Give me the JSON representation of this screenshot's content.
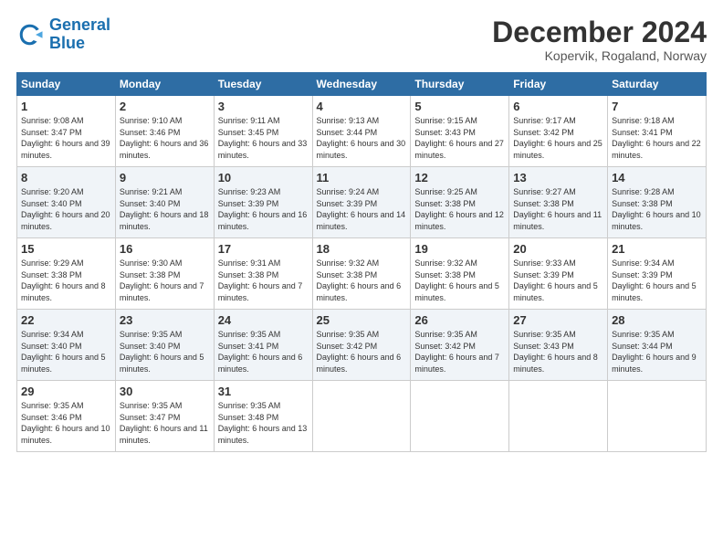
{
  "logo": {
    "line1": "General",
    "line2": "Blue"
  },
  "header": {
    "month": "December 2024",
    "location": "Kopervik, Rogaland, Norway"
  },
  "weekdays": [
    "Sunday",
    "Monday",
    "Tuesday",
    "Wednesday",
    "Thursday",
    "Friday",
    "Saturday"
  ],
  "weeks": [
    [
      {
        "day": 1,
        "sunrise": "Sunrise: 9:08 AM",
        "sunset": "Sunset: 3:47 PM",
        "daylight": "Daylight: 6 hours and 39 minutes."
      },
      {
        "day": 2,
        "sunrise": "Sunrise: 9:10 AM",
        "sunset": "Sunset: 3:46 PM",
        "daylight": "Daylight: 6 hours and 36 minutes."
      },
      {
        "day": 3,
        "sunrise": "Sunrise: 9:11 AM",
        "sunset": "Sunset: 3:45 PM",
        "daylight": "Daylight: 6 hours and 33 minutes."
      },
      {
        "day": 4,
        "sunrise": "Sunrise: 9:13 AM",
        "sunset": "Sunset: 3:44 PM",
        "daylight": "Daylight: 6 hours and 30 minutes."
      },
      {
        "day": 5,
        "sunrise": "Sunrise: 9:15 AM",
        "sunset": "Sunset: 3:43 PM",
        "daylight": "Daylight: 6 hours and 27 minutes."
      },
      {
        "day": 6,
        "sunrise": "Sunrise: 9:17 AM",
        "sunset": "Sunset: 3:42 PM",
        "daylight": "Daylight: 6 hours and 25 minutes."
      },
      {
        "day": 7,
        "sunrise": "Sunrise: 9:18 AM",
        "sunset": "Sunset: 3:41 PM",
        "daylight": "Daylight: 6 hours and 22 minutes."
      }
    ],
    [
      {
        "day": 8,
        "sunrise": "Sunrise: 9:20 AM",
        "sunset": "Sunset: 3:40 PM",
        "daylight": "Daylight: 6 hours and 20 minutes."
      },
      {
        "day": 9,
        "sunrise": "Sunrise: 9:21 AM",
        "sunset": "Sunset: 3:40 PM",
        "daylight": "Daylight: 6 hours and 18 minutes."
      },
      {
        "day": 10,
        "sunrise": "Sunrise: 9:23 AM",
        "sunset": "Sunset: 3:39 PM",
        "daylight": "Daylight: 6 hours and 16 minutes."
      },
      {
        "day": 11,
        "sunrise": "Sunrise: 9:24 AM",
        "sunset": "Sunset: 3:39 PM",
        "daylight": "Daylight: 6 hours and 14 minutes."
      },
      {
        "day": 12,
        "sunrise": "Sunrise: 9:25 AM",
        "sunset": "Sunset: 3:38 PM",
        "daylight": "Daylight: 6 hours and 12 minutes."
      },
      {
        "day": 13,
        "sunrise": "Sunrise: 9:27 AM",
        "sunset": "Sunset: 3:38 PM",
        "daylight": "Daylight: 6 hours and 11 minutes."
      },
      {
        "day": 14,
        "sunrise": "Sunrise: 9:28 AM",
        "sunset": "Sunset: 3:38 PM",
        "daylight": "Daylight: 6 hours and 10 minutes."
      }
    ],
    [
      {
        "day": 15,
        "sunrise": "Sunrise: 9:29 AM",
        "sunset": "Sunset: 3:38 PM",
        "daylight": "Daylight: 6 hours and 8 minutes."
      },
      {
        "day": 16,
        "sunrise": "Sunrise: 9:30 AM",
        "sunset": "Sunset: 3:38 PM",
        "daylight": "Daylight: 6 hours and 7 minutes."
      },
      {
        "day": 17,
        "sunrise": "Sunrise: 9:31 AM",
        "sunset": "Sunset: 3:38 PM",
        "daylight": "Daylight: 6 hours and 7 minutes."
      },
      {
        "day": 18,
        "sunrise": "Sunrise: 9:32 AM",
        "sunset": "Sunset: 3:38 PM",
        "daylight": "Daylight: 6 hours and 6 minutes."
      },
      {
        "day": 19,
        "sunrise": "Sunrise: 9:32 AM",
        "sunset": "Sunset: 3:38 PM",
        "daylight": "Daylight: 6 hours and 5 minutes."
      },
      {
        "day": 20,
        "sunrise": "Sunrise: 9:33 AM",
        "sunset": "Sunset: 3:39 PM",
        "daylight": "Daylight: 6 hours and 5 minutes."
      },
      {
        "day": 21,
        "sunrise": "Sunrise: 9:34 AM",
        "sunset": "Sunset: 3:39 PM",
        "daylight": "Daylight: 6 hours and 5 minutes."
      }
    ],
    [
      {
        "day": 22,
        "sunrise": "Sunrise: 9:34 AM",
        "sunset": "Sunset: 3:40 PM",
        "daylight": "Daylight: 6 hours and 5 minutes."
      },
      {
        "day": 23,
        "sunrise": "Sunrise: 9:35 AM",
        "sunset": "Sunset: 3:40 PM",
        "daylight": "Daylight: 6 hours and 5 minutes."
      },
      {
        "day": 24,
        "sunrise": "Sunrise: 9:35 AM",
        "sunset": "Sunset: 3:41 PM",
        "daylight": "Daylight: 6 hours and 6 minutes."
      },
      {
        "day": 25,
        "sunrise": "Sunrise: 9:35 AM",
        "sunset": "Sunset: 3:42 PM",
        "daylight": "Daylight: 6 hours and 6 minutes."
      },
      {
        "day": 26,
        "sunrise": "Sunrise: 9:35 AM",
        "sunset": "Sunset: 3:42 PM",
        "daylight": "Daylight: 6 hours and 7 minutes."
      },
      {
        "day": 27,
        "sunrise": "Sunrise: 9:35 AM",
        "sunset": "Sunset: 3:43 PM",
        "daylight": "Daylight: 6 hours and 8 minutes."
      },
      {
        "day": 28,
        "sunrise": "Sunrise: 9:35 AM",
        "sunset": "Sunset: 3:44 PM",
        "daylight": "Daylight: 6 hours and 9 minutes."
      }
    ],
    [
      {
        "day": 29,
        "sunrise": "Sunrise: 9:35 AM",
        "sunset": "Sunset: 3:46 PM",
        "daylight": "Daylight: 6 hours and 10 minutes."
      },
      {
        "day": 30,
        "sunrise": "Sunrise: 9:35 AM",
        "sunset": "Sunset: 3:47 PM",
        "daylight": "Daylight: 6 hours and 11 minutes."
      },
      {
        "day": 31,
        "sunrise": "Sunrise: 9:35 AM",
        "sunset": "Sunset: 3:48 PM",
        "daylight": "Daylight: 6 hours and 13 minutes."
      },
      null,
      null,
      null,
      null
    ]
  ]
}
